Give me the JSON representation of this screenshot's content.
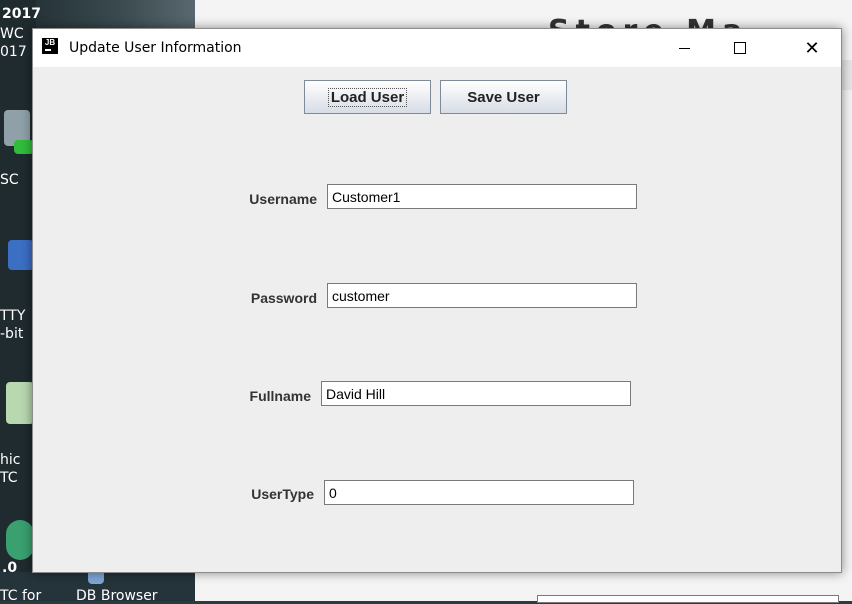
{
  "desktop": {
    "icon_labels": [
      "2017",
      "WC",
      "017",
      "SC",
      "TTY",
      "-bit",
      "hic",
      "TC",
      ".0",
      "TC for",
      "DB Browser"
    ]
  },
  "background_app": {
    "title_fragment": "Store Ma"
  },
  "window": {
    "title": "Update User Information",
    "icon_text": "JB",
    "controls": {
      "minimize": "minimize",
      "maximize": "maximize",
      "close": "✕"
    }
  },
  "toolbar": {
    "load_label": "Load User",
    "save_label": "Save User"
  },
  "form": {
    "fields": [
      {
        "label": "Username",
        "value": "Customer1"
      },
      {
        "label": "Password",
        "value": "customer"
      },
      {
        "label": "Fullname",
        "value": "David Hill"
      },
      {
        "label": "UserType",
        "value": "0"
      }
    ]
  }
}
